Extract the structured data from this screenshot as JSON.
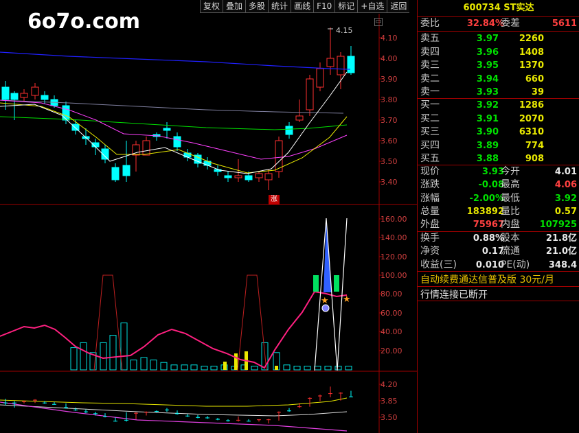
{
  "logo": "6o7o.com",
  "toolbar": [
    "复权",
    "叠加",
    "多股",
    "统计",
    "画线",
    "F10",
    "标记",
    "+自选",
    "返回"
  ],
  "main_chart": {
    "high_label": "4.15",
    "zhang_badge": "涨",
    "price_axis": [
      "4.10",
      "4.00",
      "3.90",
      "3.80",
      "3.70",
      "3.60",
      "3.50",
      "3.40"
    ],
    "colors": {
      "up": "#ff3030",
      "down": "#00ffff",
      "ma5": "#ffffff",
      "ma10": "#e8e800",
      "ma20": "#ff40ff",
      "ma60": "#00e000",
      "ma120": "#8080a0",
      "ma250": "#2020ff"
    }
  },
  "indicator_chart": {
    "axis": [
      "160.00",
      "140.00",
      "120.00",
      "100.00",
      "80.00",
      "60.00",
      "40.00",
      "20.00"
    ]
  },
  "bottom_chart": {
    "axis": [
      "4.20",
      "3.85",
      "3.50"
    ]
  },
  "panel": {
    "title": "600734 ST实达",
    "weibi_label": "委比",
    "weibi_value": "32.84%",
    "weicha_label": "委差",
    "weicha_value": "5611",
    "sell": [
      {
        "label": "卖五",
        "price": "3.97",
        "vol": "2260"
      },
      {
        "label": "卖四",
        "price": "3.96",
        "vol": "1408"
      },
      {
        "label": "卖三",
        "price": "3.95",
        "vol": "1370"
      },
      {
        "label": "卖二",
        "price": "3.94",
        "vol": "660"
      },
      {
        "label": "卖一",
        "price": "3.93",
        "vol": "39"
      }
    ],
    "buy": [
      {
        "label": "买一",
        "price": "3.92",
        "vol": "1286"
      },
      {
        "label": "买二",
        "price": "3.91",
        "vol": "2070"
      },
      {
        "label": "买三",
        "price": "3.90",
        "vol": "6310"
      },
      {
        "label": "买四",
        "price": "3.89",
        "vol": "774"
      },
      {
        "label": "买五",
        "price": "3.88",
        "vol": "908"
      }
    ],
    "stats1": [
      {
        "l1": "现价",
        "v1": "3.93",
        "c1": "g",
        "l2": "今开",
        "v2": "4.01",
        "c2": "w"
      },
      {
        "l1": "涨跌",
        "v1": "-0.08",
        "c1": "g",
        "l2": "最高",
        "v2": "4.06",
        "c2": "r"
      },
      {
        "l1": "涨幅",
        "v1": "-2.00%",
        "c1": "g",
        "l2": "最低",
        "v2": "3.92",
        "c2": "g"
      },
      {
        "l1": "总量",
        "v1": "183892",
        "c1": "y",
        "l2": "量比",
        "v2": "0.57",
        "c2": "y"
      },
      {
        "l1": "外盘",
        "v1": "75967",
        "c1": "r",
        "l2": "内盘",
        "v2": "107925",
        "c2": "g"
      }
    ],
    "stats2": [
      {
        "l1": "换手",
        "v1": "0.88%",
        "c1": "w",
        "l2": "股本",
        "v2": "21.8亿",
        "c2": "w"
      },
      {
        "l1": "净资",
        "v1": "0.17",
        "c1": "w",
        "l2": "流通",
        "v2": "21.0亿",
        "c2": "w"
      },
      {
        "l1": "收益(三)",
        "v1": "0.010",
        "c1": "w",
        "l2": "PE(动)",
        "v2": "348.4",
        "c2": "w"
      }
    ],
    "ad_text": "自动续费通达信普及版  30元/月",
    "status_text": "行情连接已断开"
  }
}
